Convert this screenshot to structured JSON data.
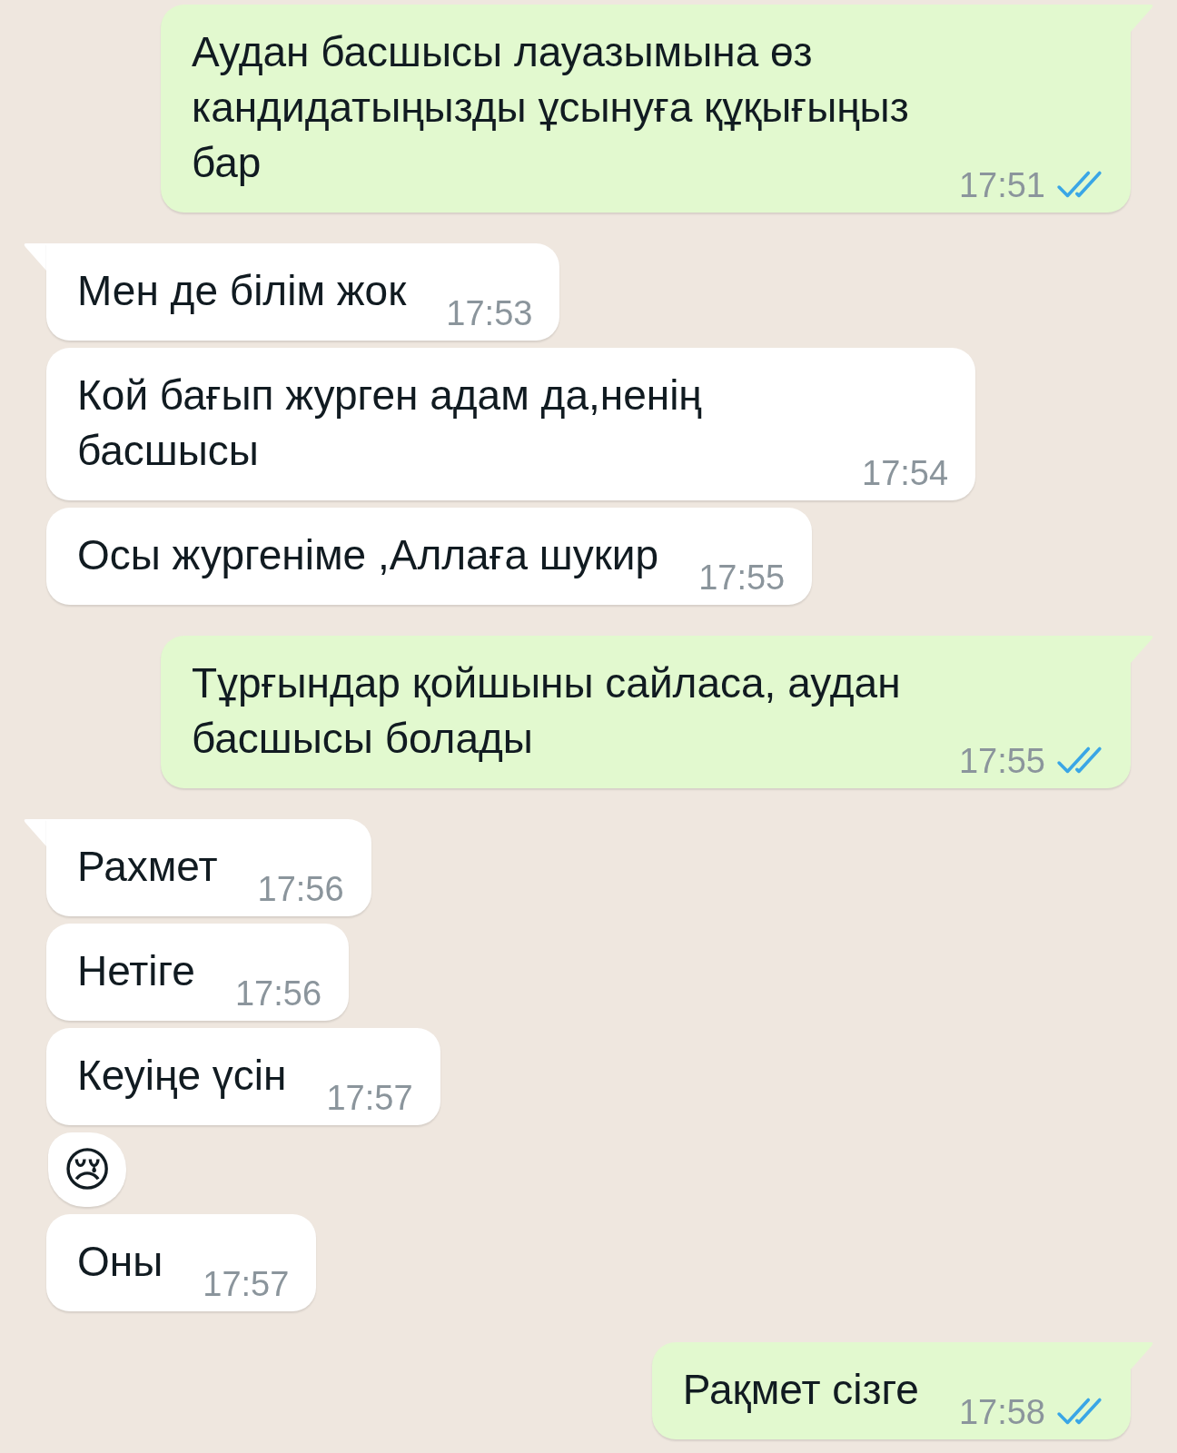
{
  "messages": [
    {
      "outgoing": true,
      "tail": true,
      "text": "Аудан басшысы лауазымына өз кандидатыңызды ұсынуға құқығыңыз бар",
      "time": "17:51",
      "read": true
    },
    {
      "outgoing": false,
      "tail": true,
      "text": "Мен де білім жок",
      "time": "17:53"
    },
    {
      "outgoing": false,
      "tail": false,
      "text": "Кой бағып журген адам да,ненің басшысы",
      "time": "17:54"
    },
    {
      "outgoing": false,
      "tail": false,
      "text": "Осы жургеніме ,Аллаға шукир",
      "time": "17:55"
    },
    {
      "outgoing": true,
      "tail": true,
      "text": "Тұрғындар қойшыны сайласа, аудан басшысы болады",
      "time": "17:55",
      "read": true
    },
    {
      "outgoing": false,
      "tail": true,
      "text": "Рахмет",
      "time": "17:56"
    },
    {
      "outgoing": false,
      "tail": false,
      "text": "Нетіге",
      "time": "17:56"
    },
    {
      "outgoing": false,
      "tail": false,
      "text": "Кеуіңе үсін",
      "time": "17:57"
    },
    {
      "outgoing": false,
      "tail": false,
      "kind": "emoji",
      "text": "😢"
    },
    {
      "outgoing": false,
      "tail": false,
      "text": "Оны",
      "time": "17:57"
    },
    {
      "outgoing": true,
      "tail": true,
      "text": "Рақмет сізге",
      "time": "17:58",
      "read": true
    }
  ]
}
